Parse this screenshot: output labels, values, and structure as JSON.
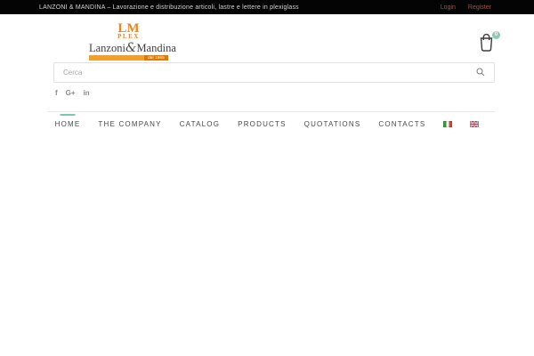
{
  "topbar": {
    "tagline": "LANZONI & MANDINA – Lavorazione e distribuzione articoli, lastre e lettere in plexiglass",
    "login_label": "Login",
    "register_label": "Register"
  },
  "header": {
    "logo": {
      "lm": "LM",
      "plex": "PLEX",
      "name_first": "Lanzoni",
      "ampersand": "&",
      "name_second": "Mandina",
      "since": "dal 1965"
    },
    "cart_count": "0"
  },
  "search": {
    "placeholder": "Cerca",
    "icon": "search-icon"
  },
  "social": {
    "facebook_glyph": "f",
    "googleplus_glyph": "G+",
    "linkedin_glyph": "in"
  },
  "nav": {
    "items": [
      {
        "label": "HOME",
        "active": true
      },
      {
        "label": "THE COMPANY",
        "active": false
      },
      {
        "label": "CATALOG",
        "active": false
      },
      {
        "label": "PRODUCTS",
        "active": false
      },
      {
        "label": "QUOTATIONS",
        "active": false
      },
      {
        "label": "CONTACTS",
        "active": false
      }
    ],
    "languages": [
      {
        "name": "italian"
      },
      {
        "name": "english"
      }
    ]
  },
  "colors": {
    "brand_orange": "#E8861C",
    "banner_orange": "#F1A02C",
    "banner_orange_dark": "#DD7B07",
    "accent_teal": "#7FC7A9",
    "cart_badge": "#8CCBB0",
    "topbar_bg": "#040404",
    "account_link": "#AB4E38"
  }
}
